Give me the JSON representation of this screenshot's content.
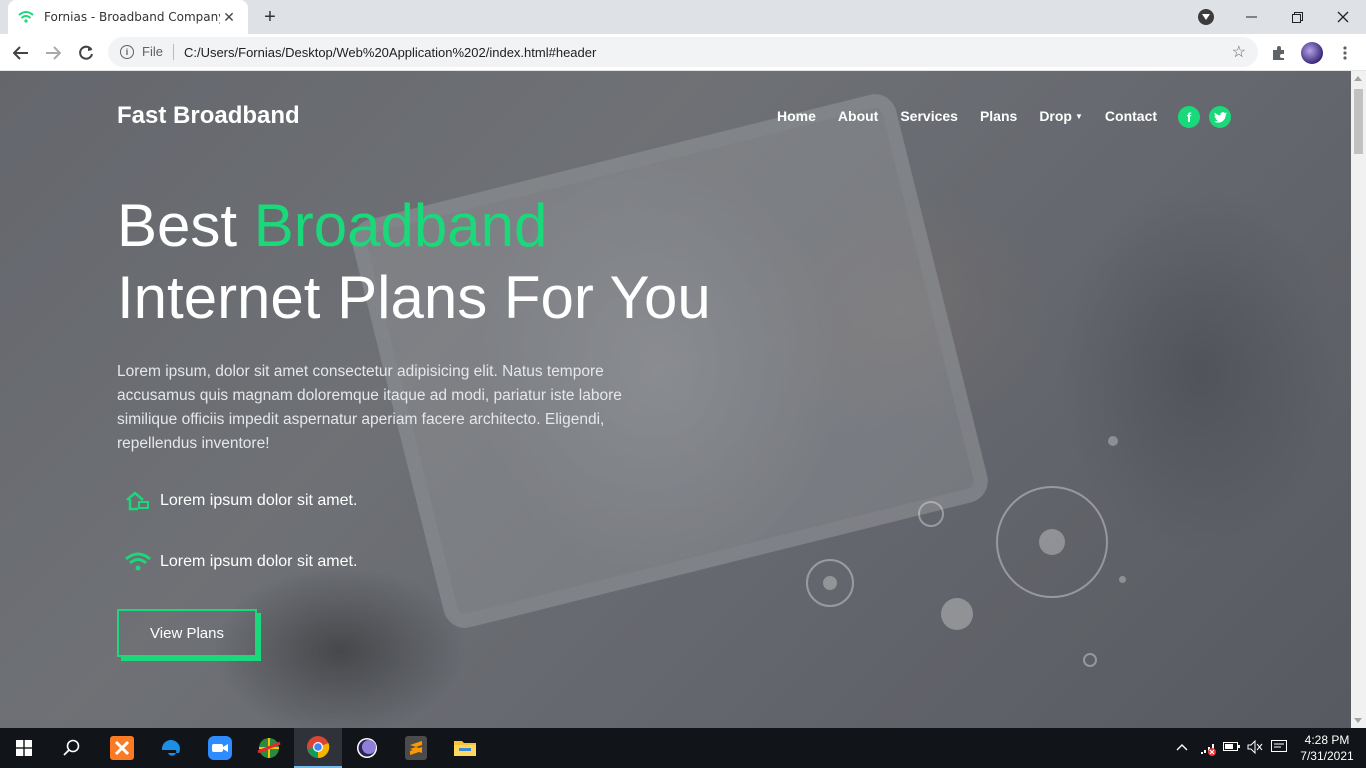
{
  "browser": {
    "tab_title": "Fornias - Broadband Company",
    "tab_close": "✕",
    "new_tab": "+",
    "url_scheme_label": "File",
    "url": "C:/Users/Fornias/Desktop/Web%20Application%202/index.html#header"
  },
  "site": {
    "brand": "Fast Broadband",
    "nav": {
      "home": "Home",
      "about": "About",
      "services": "Services",
      "plans": "Plans",
      "drop": "Drop",
      "contact": "Contact"
    },
    "hero": {
      "title_part1": "Best ",
      "title_accent": "Broadband",
      "title_line2": "Internet Plans For You",
      "lead": "Lorem ipsum, dolor sit amet consectetur adipisicing elit. Natus tempore accusamus quis magnam doloremque itaque ad modi, pariatur iste labore similique officiis impedit aspernatur aperiam facere architecto. Eligendi, repellendus inventore!",
      "features": [
        {
          "icon": "house-icon",
          "text": "Lorem ipsum dolor sit amet."
        },
        {
          "icon": "wifi-icon",
          "text": "Lorem ipsum dolor sit amet."
        }
      ],
      "cta": "View Plans"
    },
    "accent_color": "#19d97a"
  },
  "taskbar": {
    "time": "4:28 PM",
    "date": "7/31/2021"
  }
}
